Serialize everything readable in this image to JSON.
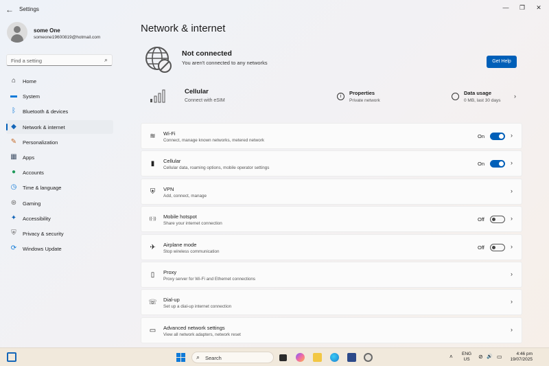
{
  "window": {
    "app_title": "Settings",
    "back_glyph": "←",
    "controls": {
      "minimize": "—",
      "restore": "❐",
      "close": "✕"
    }
  },
  "profile": {
    "name": "some One",
    "email": "someone19600819@hotmail.com"
  },
  "search": {
    "placeholder": "Find a setting",
    "icon": "⌕"
  },
  "sidebar": {
    "items": [
      {
        "label": "Home",
        "icon": "home-icon",
        "glyph": "⌂",
        "color": "#1b1b1b"
      },
      {
        "label": "System",
        "icon": "system-icon",
        "glyph": "▬",
        "color": "#0f7ad8"
      },
      {
        "label": "Bluetooth & devices",
        "icon": "bluetooth-icon",
        "glyph": "ᛒ",
        "color": "#0f7ad8"
      },
      {
        "label": "Network & internet",
        "icon": "network-icon",
        "glyph": "◆",
        "color": "#1466b8",
        "active": true
      },
      {
        "label": "Personalization",
        "icon": "brush-icon",
        "glyph": "✎",
        "color": "#c56a26"
      },
      {
        "label": "Apps",
        "icon": "apps-icon",
        "glyph": "▦",
        "color": "#44546a"
      },
      {
        "label": "Accounts",
        "icon": "accounts-icon",
        "glyph": "●",
        "color": "#1f9a5a"
      },
      {
        "label": "Time & language",
        "icon": "globe-clock-icon",
        "glyph": "◷",
        "color": "#0f7ad8"
      },
      {
        "label": "Gaming",
        "icon": "gamepad-icon",
        "glyph": "⊛",
        "color": "#6b6b6b"
      },
      {
        "label": "Accessibility",
        "icon": "accessibility-icon",
        "glyph": "✦",
        "color": "#1466b8"
      },
      {
        "label": "Privacy & security",
        "icon": "shield-icon",
        "glyph": "⛨",
        "color": "#6b6b6b"
      },
      {
        "label": "Windows Update",
        "icon": "update-icon",
        "glyph": "⟳",
        "color": "#0f7ad8"
      }
    ]
  },
  "main": {
    "title": "Network & internet",
    "status": {
      "title": "Not connected",
      "subtitle": "You aren't connected to any networks",
      "help_label": "Get Help"
    },
    "cellular_summary": {
      "title": "Cellular",
      "subtitle": "Connect with eSIM",
      "properties_title": "Properties",
      "properties_sub": "Private network",
      "usage_title": "Data usage",
      "usage_sub": "0 MB, last 30 days"
    },
    "rows": [
      {
        "title": "Wi-Fi",
        "subtitle": "Connect, manage known networks, metered network",
        "state": "On",
        "toggle": "on",
        "icon": "wifi-icon",
        "glyph": "≋"
      },
      {
        "title": "Cellular",
        "subtitle": "Cellular data, roaming options, mobile operator settings",
        "state": "On",
        "toggle": "on",
        "icon": "cellular-icon",
        "glyph": "▮"
      },
      {
        "title": "VPN",
        "subtitle": "Add, connect, manage",
        "state": "",
        "toggle": "",
        "icon": "vpn-shield-icon",
        "glyph": "⛨"
      },
      {
        "title": "Mobile hotspot",
        "subtitle": "Share your internet connection",
        "state": "Off",
        "toggle": "off",
        "icon": "hotspot-icon",
        "glyph": "((·))"
      },
      {
        "title": "Airplane mode",
        "subtitle": "Stop wireless communication",
        "state": "Off",
        "toggle": "off",
        "icon": "airplane-icon",
        "glyph": "✈"
      },
      {
        "title": "Proxy",
        "subtitle": "Proxy server for Wi-Fi and Ethernet connections",
        "state": "",
        "toggle": "",
        "icon": "proxy-icon",
        "glyph": "▯"
      },
      {
        "title": "Dial-up",
        "subtitle": "Set up a dial-up internet connection",
        "state": "",
        "toggle": "",
        "icon": "dialup-icon",
        "glyph": "☏"
      },
      {
        "title": "Advanced network settings",
        "subtitle": "View all network adapters, network reset",
        "state": "",
        "toggle": "",
        "icon": "monitor-icon",
        "glyph": "▭"
      }
    ]
  },
  "taskbar": {
    "search_label": "Search",
    "search_icon": "⌕",
    "lang_top": "ENG",
    "lang_bottom": "US",
    "time": "4:46 pm",
    "date": "19/07/2025",
    "tray_glyphs": {
      "chevron": "˄",
      "network": "⊘",
      "volume": "🔊",
      "battery": "▭"
    }
  }
}
